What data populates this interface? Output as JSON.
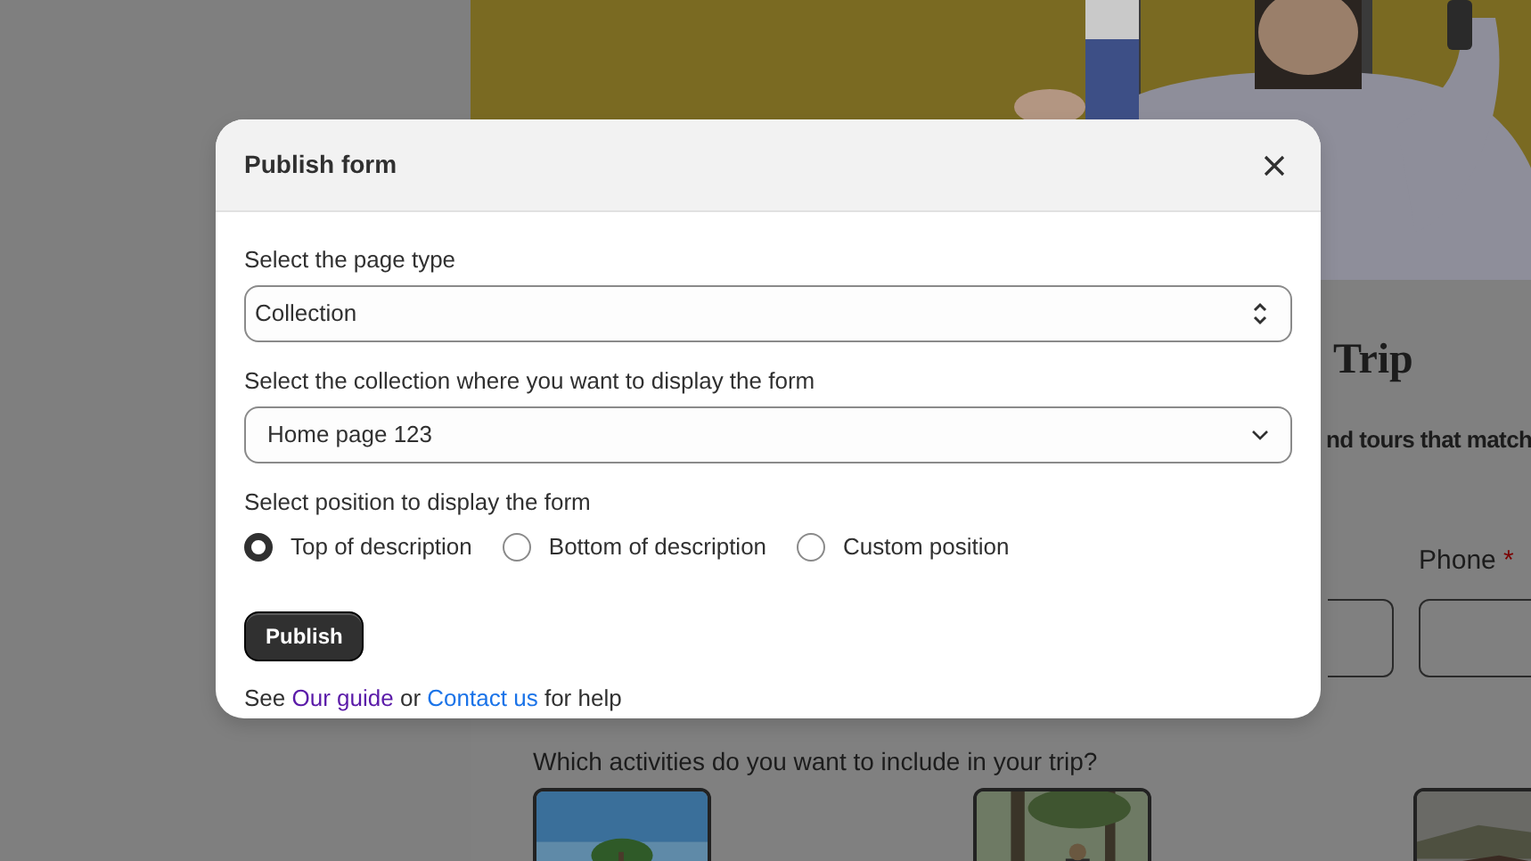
{
  "page": {
    "heading": "Trip",
    "subheading": "nd tours that match",
    "phone_label": "Phone",
    "required_mark": "*",
    "question": "Which activities do you want to include in your trip?"
  },
  "modal": {
    "title": "Publish form",
    "fields": [
      {
        "kind": "stepper",
        "label": "Select the page type",
        "value": "Collection"
      },
      {
        "kind": "dropdown",
        "label": "Select the collection where you want to display the form",
        "value": "Home page 123"
      }
    ],
    "position": {
      "label": "Select position to display the form",
      "options": [
        {
          "label": "Top of description",
          "selected": true
        },
        {
          "label": "Bottom of description",
          "selected": false
        },
        {
          "label": "Custom position",
          "selected": false
        }
      ]
    },
    "publish_button": "Publish",
    "help": {
      "before": "See",
      "guide_link": "Our guide",
      "middle": "or",
      "contact_link": "Contact us",
      "after": "for help"
    }
  }
}
